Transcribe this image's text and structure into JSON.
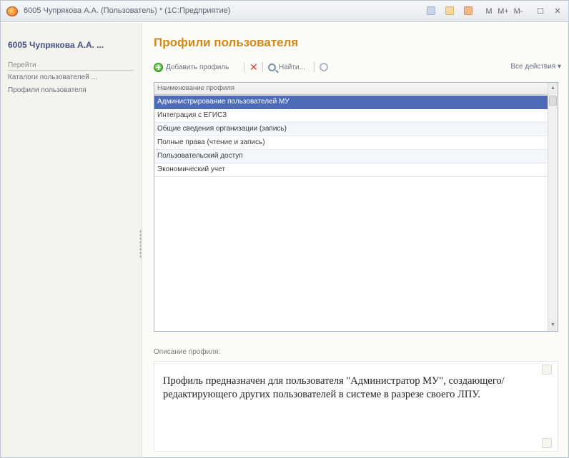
{
  "window": {
    "title": "6005 Чупрякова А.А. (Пользователь) * (1С:Предприятие)",
    "controls": [
      "M",
      "M+",
      "M-"
    ]
  },
  "sidebar": {
    "user_title": "6005 Чупрякова А.А. ...",
    "section_label": "Перейти",
    "items": [
      {
        "label": "Каталоги пользователей ..."
      },
      {
        "label": "Профили пользователя"
      }
    ]
  },
  "main": {
    "title": "Профили пользователя",
    "toolbar": {
      "add_label": "Добавить профиль",
      "find_label": "Найти...",
      "all_actions_label": "Все действия ▾"
    },
    "table": {
      "column_header": "Наименование профиля",
      "rows": [
        "Администрирование пользователей МУ",
        "Интеграция с ЕГИСЗ",
        "Общие сведения организации (запись)",
        "Полные права (чтение и запись)",
        "Пользовательский доступ",
        "Экономический учет"
      ],
      "selected_index": 0
    },
    "description": {
      "label": "Описание профиля:",
      "text": "Профиль предназначен для пользователя \"Администратор МУ\", создающего/редактирующего других пользователей в системе в разрезе своего ЛПУ."
    }
  },
  "colors": {
    "title_accent": "#d0891c",
    "selection": "#4d6bb6",
    "sidebar_title": "#4a4f86"
  }
}
